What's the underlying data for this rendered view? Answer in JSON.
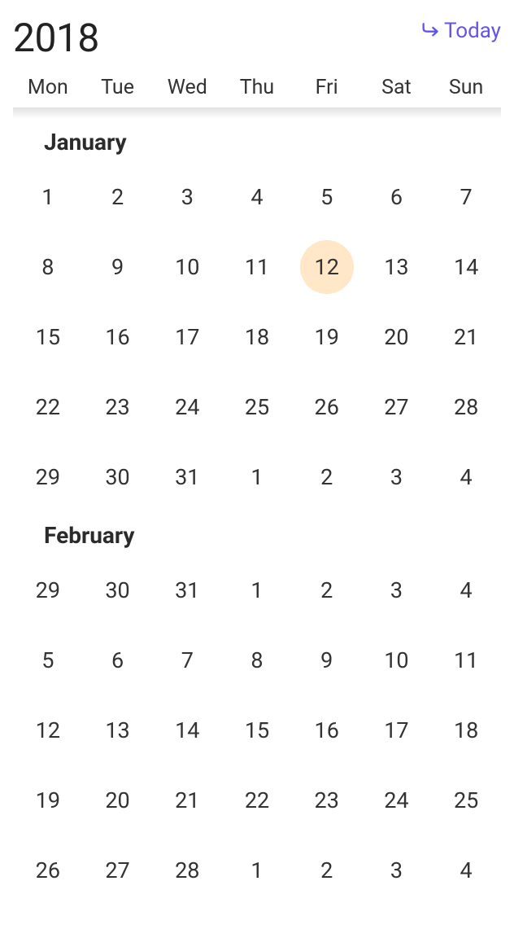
{
  "year": "2018",
  "today_label": "Today",
  "weekdays": [
    "Mon",
    "Tue",
    "Wed",
    "Thu",
    "Fri",
    "Sat",
    "Sun"
  ],
  "colors": {
    "accent": "#6356e5",
    "selected_bg": "#ffe7c7"
  },
  "months": [
    {
      "name": "January",
      "days": [
        "1",
        "2",
        "3",
        "4",
        "5",
        "6",
        "7",
        "8",
        "9",
        "10",
        "11",
        "12",
        "13",
        "14",
        "15",
        "16",
        "17",
        "18",
        "19",
        "20",
        "21",
        "22",
        "23",
        "24",
        "25",
        "26",
        "27",
        "28",
        "29",
        "30",
        "31",
        "1",
        "2",
        "3",
        "4"
      ],
      "selected_index": 11
    },
    {
      "name": "February",
      "days": [
        "29",
        "30",
        "31",
        "1",
        "2",
        "3",
        "4",
        "5",
        "6",
        "7",
        "8",
        "9",
        "10",
        "11",
        "12",
        "13",
        "14",
        "15",
        "16",
        "17",
        "18",
        "19",
        "20",
        "21",
        "22",
        "23",
        "24",
        "25",
        "26",
        "27",
        "28",
        "1",
        "2",
        "3",
        "4"
      ],
      "selected_index": -1
    }
  ]
}
